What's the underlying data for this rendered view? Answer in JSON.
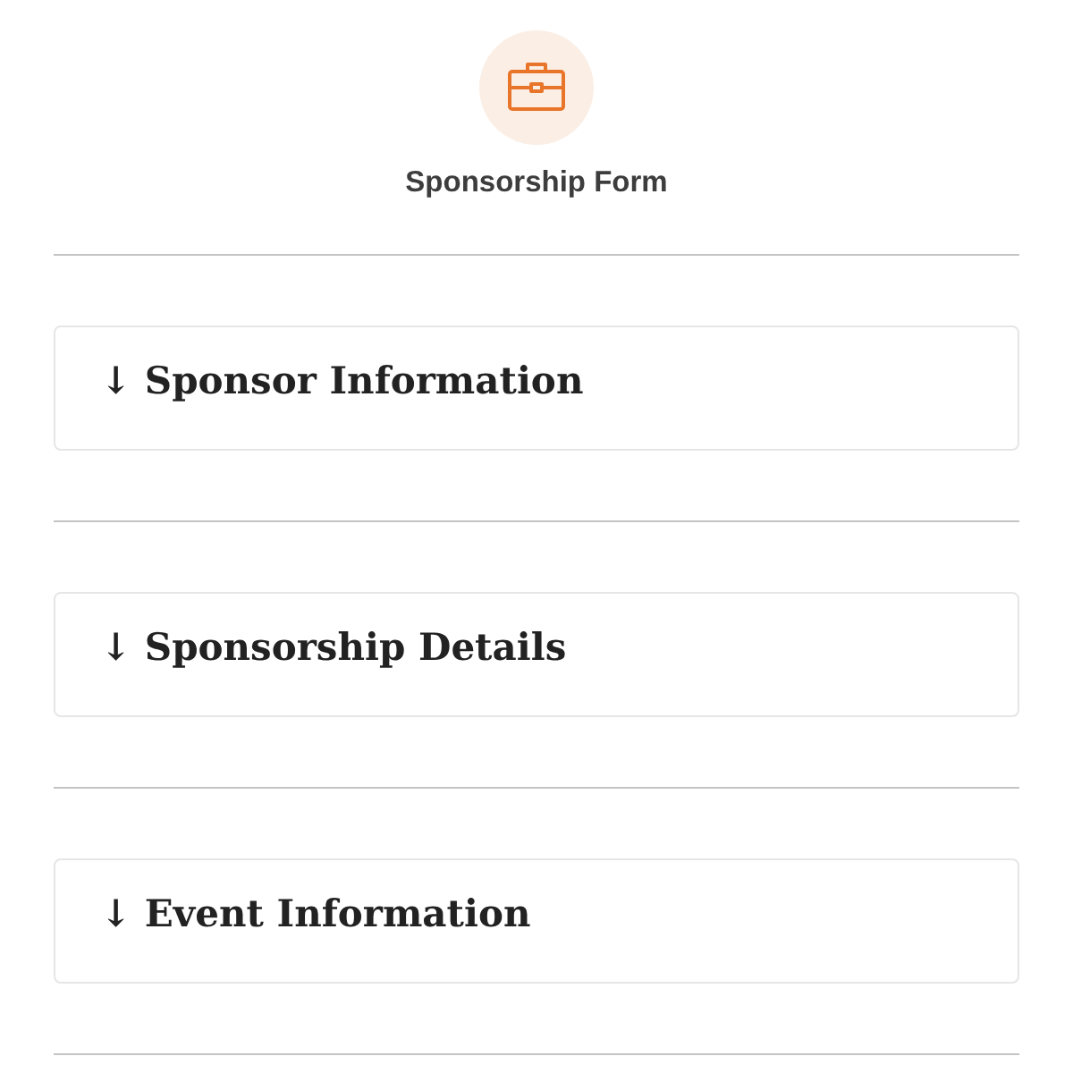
{
  "header": {
    "title": "Sponsorship Form"
  },
  "sections": [
    {
      "title": "↓ Sponsor Information"
    },
    {
      "title": "↓ Sponsorship Details"
    },
    {
      "title": "↓ Event Information"
    }
  ]
}
